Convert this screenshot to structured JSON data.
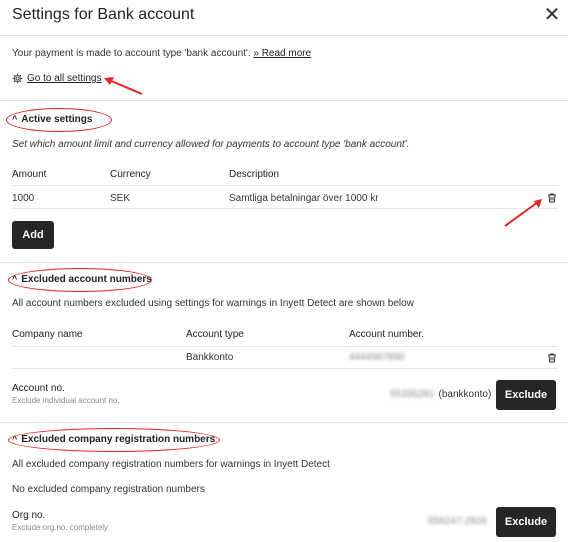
{
  "dialog": {
    "title": "Settings for Bank account",
    "close_label": "✕"
  },
  "intro": {
    "text": "Your payment is made to account type 'bank account'.",
    "read_more": "» Read more",
    "settings_link": "Go to all settings"
  },
  "active": {
    "heading": "Active settings",
    "description": "Set which amount limit and currency allowed for payments to account type 'bank account'.",
    "columns": [
      "Amount",
      "Currency",
      "Description"
    ],
    "rows": [
      {
        "amount": "1000",
        "currency": "SEK",
        "description": "Samtliga betalningar över 1000 kr"
      }
    ],
    "add_label": "Add"
  },
  "excluded_accounts": {
    "heading": "Excluded account numbers",
    "description": "All account numbers excluded using settings for warnings in Inyett Detect are shown below",
    "columns": [
      "Company name",
      "Account type",
      "Account number."
    ],
    "rows": [
      {
        "company": "",
        "type": "Bankkonto",
        "number": "4444567890"
      }
    ],
    "account_label": "Account no.",
    "account_hint": "Exclude individual account no.",
    "account_value": "55335281",
    "account_suffix": "(bankkonto)",
    "exclude_label": "Exclude"
  },
  "excluded_orgs": {
    "heading": "Excluded company registration numbers",
    "description": "All excluded company registration numbers for warnings in Inyett Detect",
    "empty_text": "No excluded company registration numbers",
    "org_label": "Org no.",
    "org_hint": "Exclude org.no. completely",
    "org_value": "556247-2926",
    "exclude_label": "Exclude"
  },
  "colors": {
    "annotation": "#e02424",
    "button": "#262626"
  }
}
